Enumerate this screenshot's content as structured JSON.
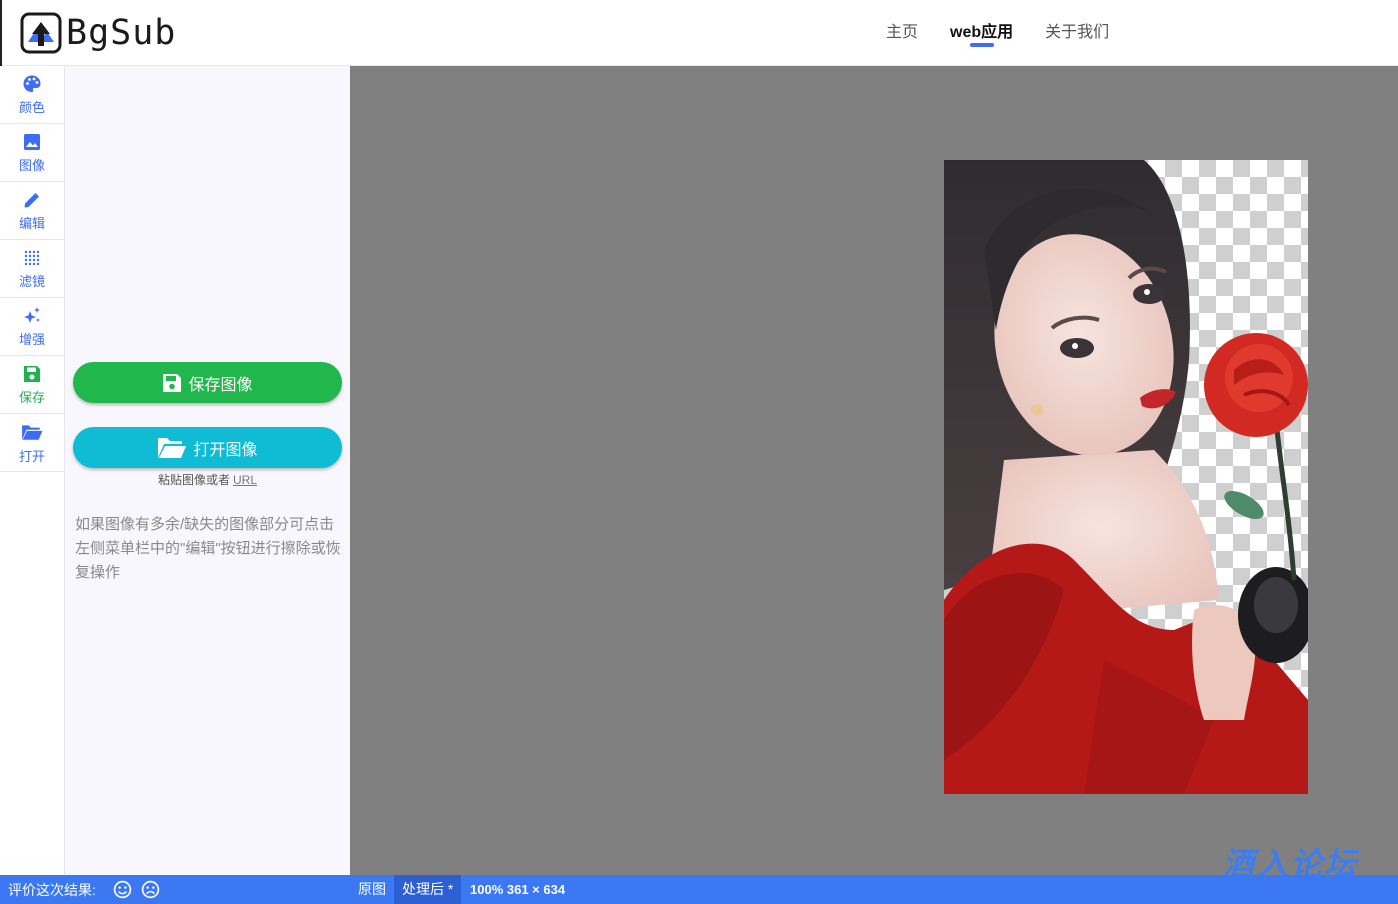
{
  "brand": {
    "name": "BgSub"
  },
  "nav": [
    {
      "label": "主页",
      "active": false
    },
    {
      "label": "web应用",
      "active": true
    },
    {
      "label": "关于我们",
      "active": false
    }
  ],
  "rail": [
    {
      "label": "颜色",
      "icon": "palette-icon"
    },
    {
      "label": "图像",
      "icon": "image-icon"
    },
    {
      "label": "编辑",
      "icon": "pencil-icon"
    },
    {
      "label": "滤镜",
      "icon": "dots-grid-icon"
    },
    {
      "label": "增强",
      "icon": "sparkles-icon"
    },
    {
      "label": "保存",
      "icon": "floppy-icon"
    },
    {
      "label": "打开",
      "icon": "folder-open-icon"
    }
  ],
  "panel": {
    "save_label": "保存图像",
    "open_label": "打开图像",
    "paste_text": "粘贴图像或者",
    "paste_url": "URL",
    "tip": "如果图像有多余/缺失的图像部分可点击左侧菜单栏中的\"编辑\"按钮进行擦除或恢复操作"
  },
  "canvas": {
    "watermark": "酒入论坛"
  },
  "statusbar": {
    "rate_label": "评价这次结果:",
    "tab_original": "原图",
    "tab_processed": "处理后 *",
    "zoom": "100% 361 × 634"
  },
  "colors": {
    "accent": "#3d6df5",
    "save": "#22b74c",
    "open": "#10bcd4",
    "status": "#3c78f2",
    "canvas": "#808080"
  }
}
